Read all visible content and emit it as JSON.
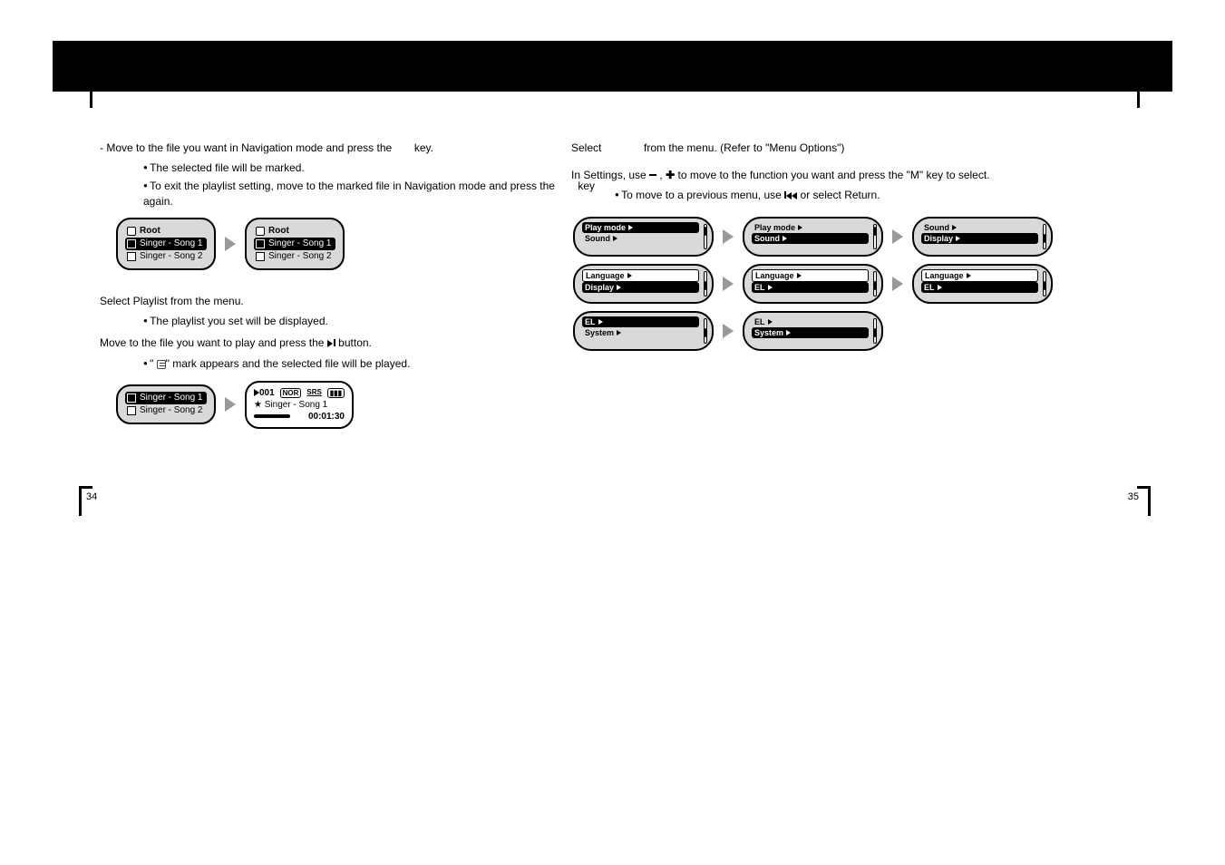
{
  "left": {
    "step_move": "- Move to the file you want in Navigation mode and press the",
    "step_move_tail": "key.",
    "b1": "The selected file will be marked.",
    "b2_a": "To exit the playlist setting, move to the marked file in Navigation mode and press the",
    "b2_b": "key again.",
    "root": "Root",
    "item1": "Singer - Song 1",
    "item2": "Singer - Song 2",
    "playlist_step": "Select Playlist from the menu.",
    "playlist_b": "The playlist you set will be displayed.",
    "move_step_a": "Move to the file you want to play and press the",
    "move_step_b": "button.",
    "move_b_a": "\" ",
    "move_b_b": "\" mark appears and the selected file will be played.",
    "play_num": "001",
    "play_nor": "NOR",
    "play_srs": "SRS",
    "play_time": "00:01:30",
    "play_title": "Singer - Song 1"
  },
  "right": {
    "s1_a": "Select",
    "s1_b": "from the menu. (Refer to \"Menu Options\")",
    "s2_a": "In Settings, use",
    "s2_b": "to move to the function you want and press the \"M\" key to select.",
    "s2_bullet_a": "To move to a previous menu, use",
    "s2_bullet_b": "or select Return.",
    "opt_playmode": "Play mode",
    "opt_sound": "Sound",
    "opt_display": "Display",
    "opt_language": "Language",
    "opt_el": "EL",
    "opt_system": "System"
  },
  "page_left": "34",
  "page_right": "35"
}
